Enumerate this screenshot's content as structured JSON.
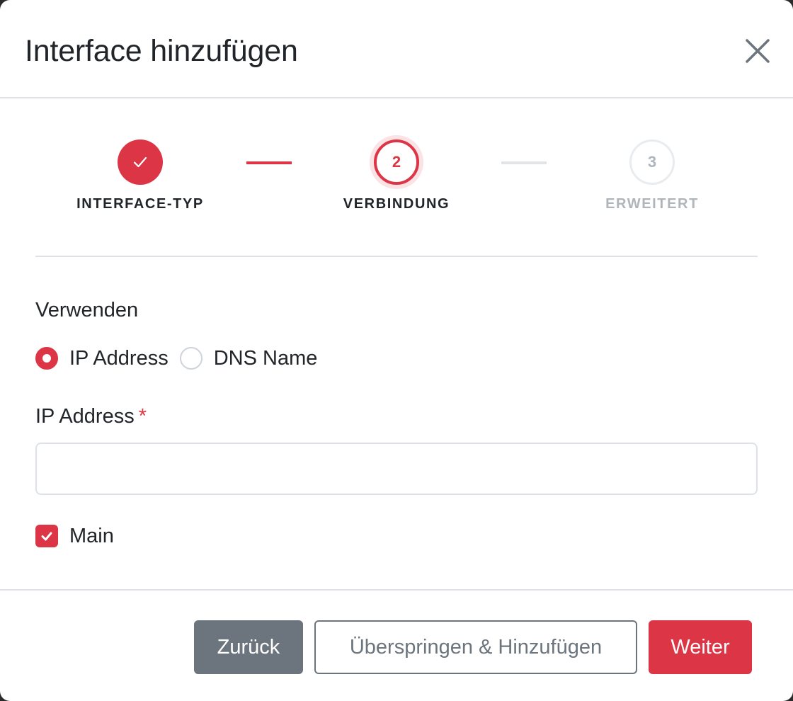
{
  "modal": {
    "title": "Interface hinzufügen"
  },
  "stepper": {
    "steps": [
      {
        "number": "1",
        "label": "INTERFACE-TYP",
        "state": "done"
      },
      {
        "number": "2",
        "label": "VERBINDUNG",
        "state": "active"
      },
      {
        "number": "3",
        "label": "ERWEITERT",
        "state": "pending"
      }
    ]
  },
  "form": {
    "use_label": "Verwenden",
    "radio_options": [
      {
        "label": "IP Address",
        "checked": true
      },
      {
        "label": "DNS Name",
        "checked": false
      }
    ],
    "ip_label": "IP Address",
    "required_marker": "*",
    "ip_value": "",
    "main_checkbox_label": "Main",
    "main_checked": true
  },
  "footer": {
    "back_label": "Zurück",
    "skip_label": "Überspringen & Hinzufügen",
    "next_label": "Weiter"
  },
  "colors": {
    "accent": "#dc3545",
    "secondary": "#6c757d",
    "border": "#dee2e6"
  }
}
